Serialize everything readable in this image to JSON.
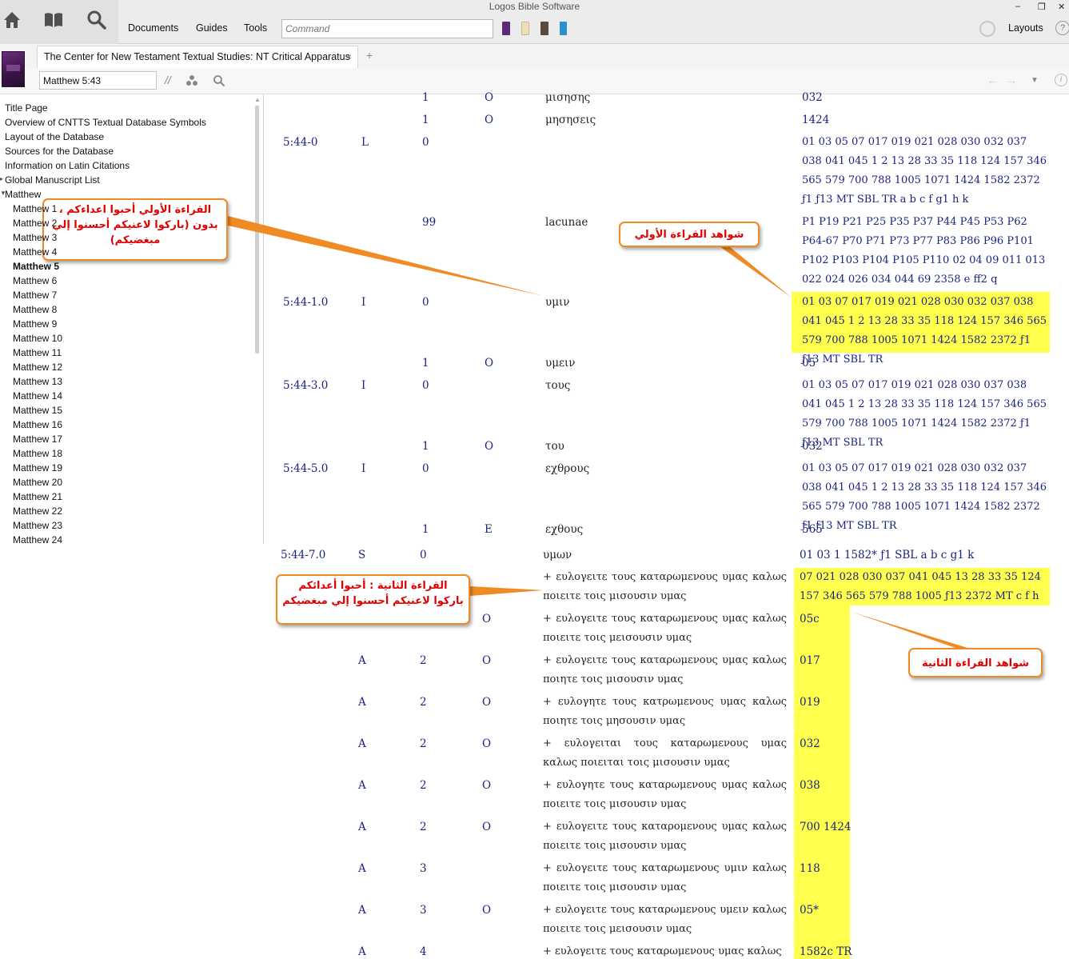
{
  "app": {
    "title": "Logos Bible Software",
    "menu": [
      "Documents",
      "Guides",
      "Tools"
    ],
    "command_placeholder": "Command",
    "layouts_label": "Layouts",
    "help_label": "?",
    "window_buttons": [
      "–",
      "❐",
      "✕"
    ]
  },
  "resource": {
    "tab_title": "The Center for New Testament Textual Studies: NT Critical Apparatus",
    "tab_close": "×",
    "tab_add": "+",
    "reference_value": "Matthew 5:43",
    "parallel_icon": "//"
  },
  "toc": {
    "items": [
      {
        "label": "Title Page",
        "sub": false,
        "bold": false
      },
      {
        "label": "Overview of CNTTS Textual Database Symbols",
        "sub": false,
        "bold": false
      },
      {
        "label": "Layout of the Database",
        "sub": false,
        "bold": false
      },
      {
        "label": "Sources for the Database",
        "sub": false,
        "bold": false
      },
      {
        "label": "Information on Latin Citations",
        "sub": false,
        "bold": false
      },
      {
        "label": "Global Manuscript List",
        "sub": false,
        "bold": false
      },
      {
        "label": "Matthew",
        "sub": false,
        "bold": false
      },
      {
        "label": "Matthew 1",
        "sub": true,
        "bold": false
      },
      {
        "label": "Matthew 2",
        "sub": true,
        "bold": false
      },
      {
        "label": "Matthew 3",
        "sub": true,
        "bold": false
      },
      {
        "label": "Matthew 4",
        "sub": true,
        "bold": false
      },
      {
        "label": "Matthew 5",
        "sub": true,
        "bold": true
      },
      {
        "label": "Matthew 6",
        "sub": true,
        "bold": false
      },
      {
        "label": "Matthew 7",
        "sub": true,
        "bold": false
      },
      {
        "label": "Matthew 8",
        "sub": true,
        "bold": false
      },
      {
        "label": "Matthew 9",
        "sub": true,
        "bold": false
      },
      {
        "label": "Matthew 10",
        "sub": true,
        "bold": false
      },
      {
        "label": "Matthew 11",
        "sub": true,
        "bold": false
      },
      {
        "label": "Matthew 12",
        "sub": true,
        "bold": false
      },
      {
        "label": "Matthew 13",
        "sub": true,
        "bold": false
      },
      {
        "label": "Matthew 14",
        "sub": true,
        "bold": false
      },
      {
        "label": "Matthew 15",
        "sub": true,
        "bold": false
      },
      {
        "label": "Matthew 16",
        "sub": true,
        "bold": false
      },
      {
        "label": "Matthew 17",
        "sub": true,
        "bold": false
      },
      {
        "label": "Matthew 18",
        "sub": true,
        "bold": false
      },
      {
        "label": "Matthew 19",
        "sub": true,
        "bold": false
      },
      {
        "label": "Matthew 20",
        "sub": true,
        "bold": false
      },
      {
        "label": "Matthew 21",
        "sub": true,
        "bold": false
      },
      {
        "label": "Matthew 22",
        "sub": true,
        "bold": false
      },
      {
        "label": "Matthew 23",
        "sub": true,
        "bold": false
      },
      {
        "label": "Matthew 24",
        "sub": true,
        "bold": false
      }
    ]
  },
  "apparatus": {
    "rows": [
      {
        "ref": "",
        "type": "",
        "num": "1",
        "mark": "O",
        "reading": "μισησης",
        "witnesses": "032"
      },
      {
        "ref": "",
        "type": "",
        "num": "1",
        "mark": "O",
        "reading": "μησησεις",
        "witnesses": "1424"
      },
      {
        "ref": "5:44-0",
        "type": "L",
        "num": "0",
        "mark": "",
        "reading": "",
        "witnesses": "01 03 05 07 017 019 021 028 030 032 037 038 041 045 1 2 13 28 33 35 118 124 157 346 565 579 700 788 1005 1071 1424 1582 2372 ƒ1 ƒ13 MT SBL TR a b c f g1 h k"
      },
      {
        "ref": "",
        "type": "",
        "num": "99",
        "mark": "",
        "reading": "lacunae",
        "witnesses": "P1 P19 P21 P25 P35 P37 P44 P45 P53 P62 P64-67 P70 P71 P73 P77 P83 P86 P96 P101 P102 P103 P104 P105 P110 02 04 09 011 013 022 024 026 034 044 69 2358 e ff2 q"
      },
      {
        "ref": "5:44-1.0",
        "type": "I",
        "num": "0",
        "mark": "",
        "reading": "υμιν",
        "witnesses": "01 03 07 017 019 021 028 030 032 037 038 041 045 1 2 13 28 33 35 118 124 157 346 565 579 700 788 1005 1071 1424 1582 2372 ƒ1 ƒ13 MT SBL TR"
      },
      {
        "ref": "",
        "type": "",
        "num": "1",
        "mark": "O",
        "reading": "υμειν",
        "witnesses": "05"
      },
      {
        "ref": "5:44-3.0",
        "type": "I",
        "num": "0",
        "mark": "",
        "reading": "τους",
        "witnesses": "01 03 05 07 017 019 021 028 030 037 038 041 045 1 2 13 28 33 35 118 124 157 346 565 579 700 788 1005 1071 1424 1582 2372 ƒ1 ƒ13 MT SBL TR"
      },
      {
        "ref": "",
        "type": "",
        "num": "1",
        "mark": "O",
        "reading": "του",
        "witnesses": "032"
      },
      {
        "ref": "5:44-5.0",
        "type": "I",
        "num": "0",
        "mark": "",
        "reading": "εχθρους",
        "witnesses": "01 03 05 07 017 019 021 028 030 032 037 038 041 045 1 2 13 28 33 35 118 124 157 346 565 579 700 788 1005 1071 1424 1582 2372 ƒ1 ƒ13 MT SBL TR"
      },
      {
        "ref": "",
        "type": "",
        "num": "1",
        "mark": "E",
        "reading": "εχθους",
        "witnesses": "565"
      },
      {
        "ref": "5:44-7.0",
        "type": "S",
        "num": "0",
        "mark": "",
        "reading": "υμων",
        "witnesses": "01 03 1 1582* ƒ1 SBL a b c g1 k"
      },
      {
        "ref": "",
        "type": "",
        "num": "",
        "mark": "",
        "reading": "+ ευλογειτε τους καταρωμενους υμας καλως ποιειτε τοις μισουσιν υμας",
        "witnesses": "07 021 028 030 037 041 045 13 28 33 35 124 157 346 565 579 788 1005 ƒ13 2372 MT c f h"
      },
      {
        "ref": "",
        "type": "",
        "num": "",
        "mark": "O",
        "reading": "+ ευλογειτε τους καταρωμενους υμας καλως ποιειτε τοις μεισουσιν υμας",
        "witnesses": "05c"
      },
      {
        "ref": "",
        "type": "A",
        "num": "2",
        "mark": "O",
        "reading": "+ ευλογειτε τους καταρωμενους υμας καλως ποιητε τοις μισουσιν υμας",
        "witnesses": "017"
      },
      {
        "ref": "",
        "type": "A",
        "num": "2",
        "mark": "O",
        "reading": "+ ευλογητε τους κατρωμενους υμας καλως ποιητε τοις μησουσιν υμας",
        "witnesses": "019"
      },
      {
        "ref": "",
        "type": "A",
        "num": "2",
        "mark": "O",
        "reading": "+ ευλογειται τους καταρωμενους υμας καλως ποιειται τοις μισουσιν υμας",
        "witnesses": "032"
      },
      {
        "ref": "",
        "type": "A",
        "num": "2",
        "mark": "O",
        "reading": "+ ευλογητε τους καταρωμενους υμας καλως ποιειτε τοις μισουσιν υμας",
        "witnesses": "038"
      },
      {
        "ref": "",
        "type": "A",
        "num": "2",
        "mark": "O",
        "reading": "+ ευλογειτε τους καταρομενους υμας καλως ποιειτε τοις μισουσιν υμας",
        "witnesses": "700 1424"
      },
      {
        "ref": "",
        "type": "A",
        "num": "3",
        "mark": "",
        "reading": "+ ευλογειτε τους καταρωμενους υμιν καλως ποιειτε τοις μισουσιν υμας",
        "witnesses": "118"
      },
      {
        "ref": "",
        "type": "A",
        "num": "3",
        "mark": "O",
        "reading": "+ ευλογειτε τους καταρωμενους υμειν καλως ποιειτε τοις μεισουσιν υμας",
        "witnesses": "05*"
      },
      {
        "ref": "",
        "type": "A",
        "num": "4",
        "mark": "",
        "reading": "+ ευλογειτε τους καταρωμενους υμας καλως",
        "witnesses": "1582c TR"
      }
    ]
  },
  "annotations": {
    "first_reading": "القراءة الأولي أحبوا اعداءكم ، بدون (باركوا لاعنيكم أحسنوا إلي مبغضيكم)",
    "first_witnesses": "شواهد القراءة الأولي",
    "second_reading": "القراءة الثانية : أحبوا أعدائكم باركوا لاعنيكم أحسنوا إلي مبغضيكم",
    "second_witnesses": "شواهد القراءة الثانية",
    "highlight_color": "#ffff4d",
    "callout_border_color": "#f08a24",
    "callout_text_color": "#e00000"
  },
  "icons": [
    "home-icon",
    "library-icon",
    "search-icon",
    "sync-icon",
    "help-icon",
    "visual-filter-icon",
    "search-small-icon",
    "back-icon",
    "forward-icon",
    "dropdown-icon"
  ]
}
